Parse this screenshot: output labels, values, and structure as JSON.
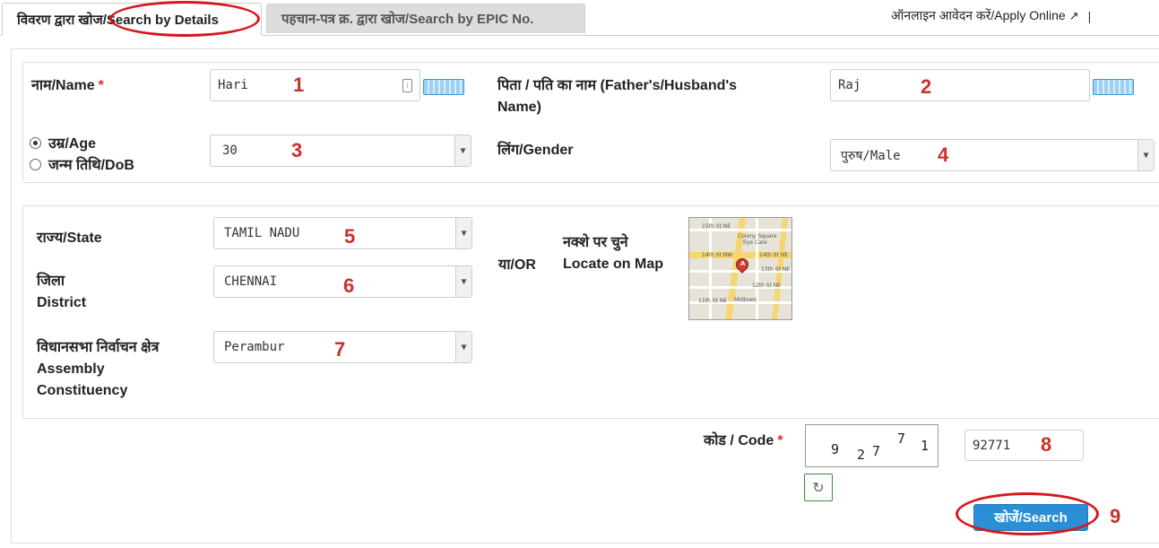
{
  "tabs": {
    "details": "विवरण द्वारा खोज/Search by Details",
    "epic": "पहचान-पत्र क्र. द्वारा खोज/Search by EPIC No.",
    "apply_online": "ऑनलाइन आवेदन करें/Apply Online",
    "separator": "|"
  },
  "form": {
    "name_label": "नाम/Name",
    "required_mark": "*",
    "name_value": "Hari",
    "father_label_line1": "पिता / पति का नाम (Father's/Husband's",
    "father_label_line2": "Name)",
    "father_value": "Raj",
    "age_option": "उम्र/Age",
    "dob_option": "जन्म तिथि/DoB",
    "age_value": "30",
    "gender_label": "लिंग/Gender",
    "gender_value": "पुरुष/Male",
    "state_label": "राज्य/State",
    "state_value": "TAMIL NADU",
    "district_label_line1": "जिला",
    "district_label_line2": "District",
    "district_value": "CHENNAI",
    "ac_label_line1": "विधानसभा निर्वाचन क्षेत्र",
    "ac_label_line2": "Assembly",
    "ac_label_line3": "Constituency",
    "ac_value": "Perambur",
    "or_label": "या/OR",
    "map_label_line1": "नक्शे पर चुने",
    "map_label_line2": "Locate on Map",
    "code_label": "कोड / Code",
    "captcha_chars": [
      "9",
      "2",
      "7",
      "7",
      "1"
    ],
    "code_value": "92771",
    "search_button": "खोजें/Search"
  },
  "map_text": {
    "street1": "15th St NE",
    "street2": "Colony Square",
    "street3": "Eye Care",
    "street4": "14th St NW",
    "street5": "14th St NE",
    "street6": "13th St NE",
    "street7": "12th St NE",
    "street8": "11th St NE",
    "street9": "Midtown",
    "pin_label": "A"
  },
  "annotations": [
    "1",
    "2",
    "3",
    "4",
    "5",
    "6",
    "7",
    "8",
    "9"
  ]
}
